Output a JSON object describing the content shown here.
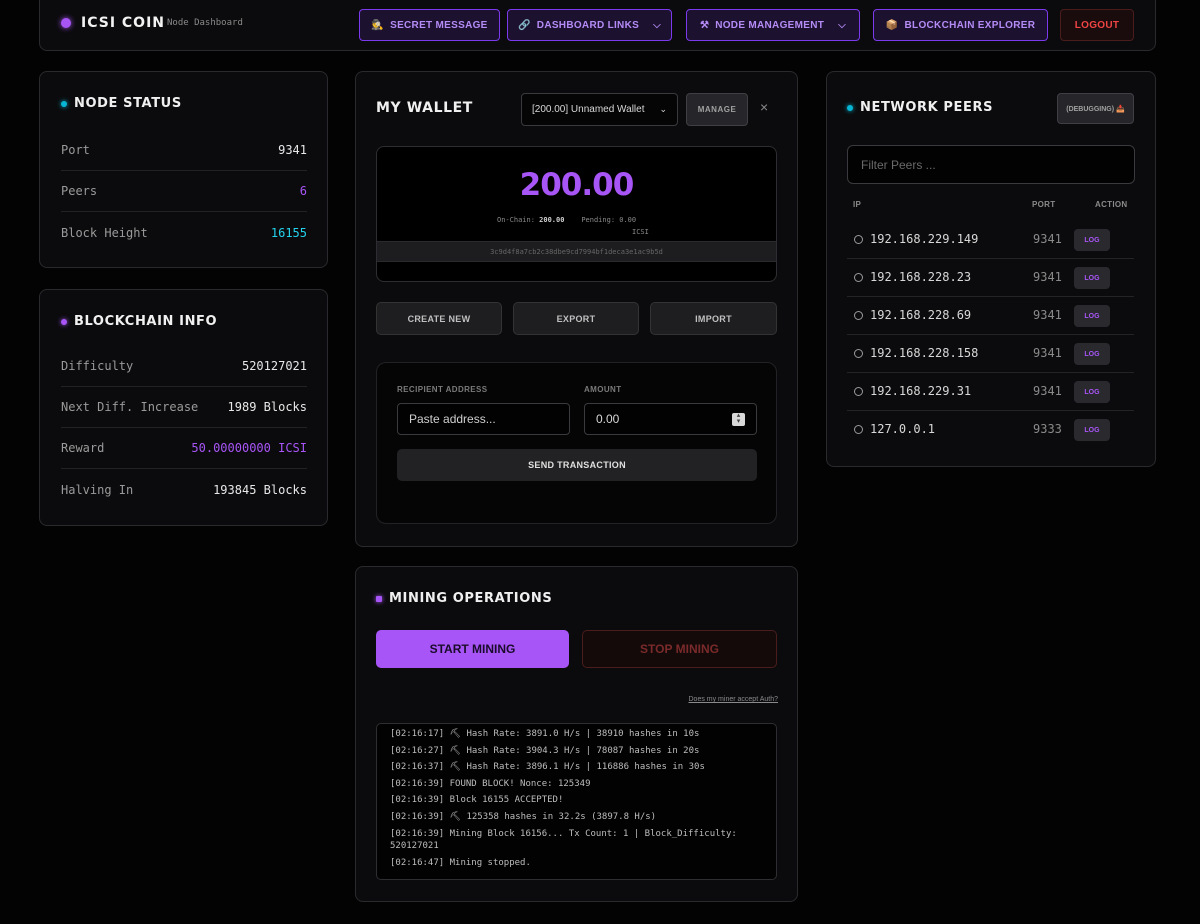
{
  "header": {
    "brand": "ICSI COIN",
    "subtitle": "Node Dashboard",
    "nav": {
      "secret": {
        "icon": "🕵",
        "label": "SECRET MESSAGE"
      },
      "links": {
        "icon": "🔗",
        "label": "DASHBOARD LINKS"
      },
      "node": {
        "icon": "⚒",
        "label": "NODE MANAGEMENT"
      },
      "explorer": {
        "icon": "📦",
        "label": "BLOCKCHAIN EXPLORER"
      },
      "logout": "LOGOUT"
    }
  },
  "node_status": {
    "title": "NODE STATUS",
    "rows": [
      {
        "key": "Port",
        "value": "9341"
      },
      {
        "key": "Peers",
        "value": "6"
      },
      {
        "key": "Block Height",
        "value": "16155"
      }
    ]
  },
  "blockchain_info": {
    "title": "BLOCKCHAIN INFO",
    "rows": [
      {
        "key": "Difficulty",
        "value": "520127021"
      },
      {
        "key": "Next Diff. Increase",
        "value": "1989 Blocks"
      },
      {
        "key": "Reward",
        "value": "50.00000000 ICSI"
      },
      {
        "key": "Halving In",
        "value": "193845 Blocks"
      }
    ]
  },
  "wallet": {
    "title": "MY WALLET",
    "selected": "[200.00] Unnamed Wallet",
    "manage": "MANAGE",
    "close": "×",
    "balance": "200.00",
    "onchain_label": "On-Chain:",
    "onchain_value": "200.00",
    "pending_label": "Pending:",
    "pending_value": "0.00",
    "unit": "ICSI",
    "address": "3c9d4f8a7cb2c38dbe9cd7994bf1deca3e1ac9b5d",
    "actions": {
      "create": "CREATE NEW",
      "export": "EXPORT",
      "import": "IMPORT"
    },
    "tx": {
      "recipient_label": "RECIPIENT ADDRESS",
      "recipient_placeholder": "Paste address...",
      "amount_label": "AMOUNT",
      "amount_value": "0.00",
      "send": "SEND TRANSACTION"
    }
  },
  "mining": {
    "title": "MINING OPERATIONS",
    "start": "START MINING",
    "stop": "STOP MINING",
    "link": "Does my miner accept Auth?",
    "log": [
      "[02:16:17] ⛏ Hash Rate: 3891.0 H/s | 38910 hashes in 10s",
      "[02:16:27] ⛏ Hash Rate: 3904.3 H/s | 78087 hashes in 20s",
      "[02:16:37] ⛏ Hash Rate: 3896.1 H/s | 116886 hashes in 30s",
      "[02:16:39] FOUND BLOCK! Nonce: 125349",
      "[02:16:39] Block 16155 ACCEPTED!",
      "[02:16:39] ⛏ 125358 hashes in 32.2s (3897.8 H/s)",
      "[02:16:39] Mining Block 16156... Tx Count: 1 | Block_Difficulty: 520127021",
      "[02:16:47] Mining stopped."
    ]
  },
  "peers": {
    "title": "NETWORK PEERS",
    "debug": "(DEBUGGING) 📥",
    "filter_placeholder": "Filter Peers ...",
    "headers": {
      "ip": "IP",
      "port": "PORT",
      "action": "ACTION"
    },
    "rows": [
      {
        "ip": "192.168.229.149",
        "port": "9341",
        "action": "LOG"
      },
      {
        "ip": "192.168.228.23",
        "port": "9341",
        "action": "LOG"
      },
      {
        "ip": "192.168.228.69",
        "port": "9341",
        "action": "LOG"
      },
      {
        "ip": "192.168.228.158",
        "port": "9341",
        "action": "LOG"
      },
      {
        "ip": "192.168.229.31",
        "port": "9341",
        "action": "LOG"
      },
      {
        "ip": "127.0.0.1",
        "port": "9333",
        "action": "LOG"
      }
    ]
  },
  "colors": {
    "accent": "#a855f7",
    "cyan": "#22d3ee",
    "danger": "#ef4444",
    "bg": "#030303"
  }
}
